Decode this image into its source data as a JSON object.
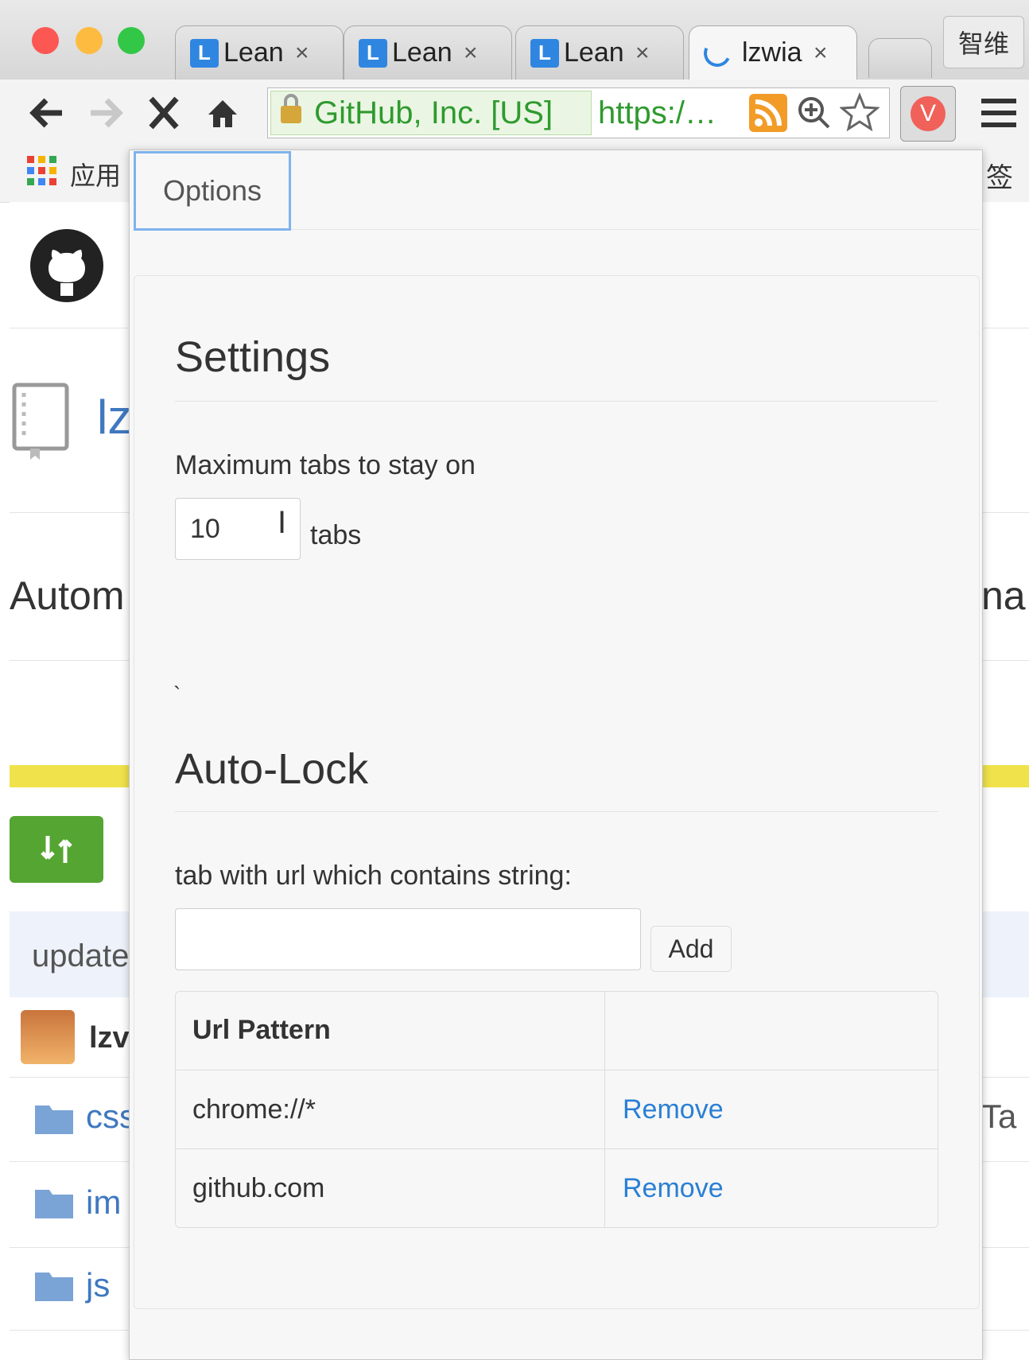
{
  "browser": {
    "tabs": [
      {
        "favicon": "L",
        "title": "Lean",
        "close": "×"
      },
      {
        "favicon": "L",
        "title": "Lean",
        "close": "×"
      },
      {
        "favicon": "L",
        "title": "Lean",
        "close": "×"
      },
      {
        "favicon": "",
        "title": "lzwia",
        "close": "×"
      }
    ],
    "profile_button": "智维",
    "security_label": "GitHub, Inc. [US]",
    "url": "https:/…",
    "extension_badge": "V",
    "bookmarks_apps_label": "应用",
    "bookmarks_right_label": "签"
  },
  "background_page": {
    "repo_fragment": "lz",
    "desc_fragment": "Autom",
    "desc_fragment_right": "na",
    "commit_fragment": "update",
    "author_fragment": "lzv",
    "files": [
      "css",
      "im",
      "js"
    ],
    "right_fragment": "Ta"
  },
  "popup": {
    "nav_tab": "Options",
    "settings": {
      "heading": "Settings",
      "max_tabs_label": "Maximum tabs to stay on",
      "max_tabs_value": "10",
      "max_tabs_unit": "tabs",
      "stray_mark": "`"
    },
    "autolock": {
      "heading": "Auto-Lock",
      "url_contains_label": "tab with url which contains string:",
      "pattern_input_value": "",
      "add_button": "Add",
      "table": {
        "header": [
          "Url Pattern",
          ""
        ],
        "rows": [
          {
            "pattern": "chrome://*",
            "action": "Remove"
          },
          {
            "pattern": "github.com",
            "action": "Remove"
          }
        ]
      }
    }
  },
  "colors": {
    "link": "#2a7fd4",
    "secure": "#2f9a2f",
    "focus": "#7fb3ec"
  }
}
